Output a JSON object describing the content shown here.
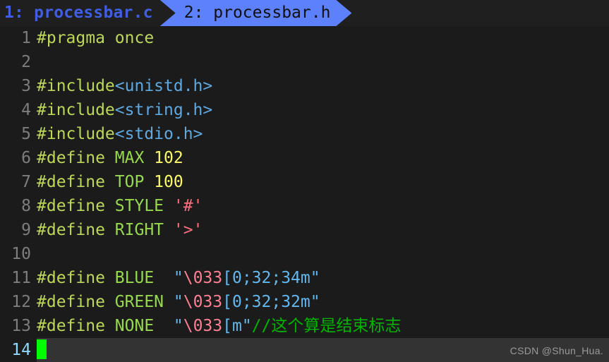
{
  "window": {
    "background": "#1b1b1b",
    "editor": "vim"
  },
  "tabline": {
    "background": "#1f1f1f",
    "tabs": [
      {
        "label": "1: processbar.c",
        "active": false,
        "text_color": "#3f5fe0"
      },
      {
        "label": "2: processbar.h",
        "active": true,
        "text_color": "#101010",
        "background": "#5d80fb"
      }
    ]
  },
  "gutter": {
    "number_color": "#7d7d7d",
    "current_number_color": "#8fd8ff"
  },
  "lines": [
    {
      "n": "1",
      "tokens": [
        {
          "t": "#pragma once",
          "c": "t-pre"
        }
      ]
    },
    {
      "n": "2",
      "tokens": []
    },
    {
      "n": "3",
      "tokens": [
        {
          "t": "#include",
          "c": "t-pre"
        },
        {
          "t": "<unistd.h>",
          "c": "t-hdr"
        }
      ]
    },
    {
      "n": "4",
      "tokens": [
        {
          "t": "#include",
          "c": "t-pre"
        },
        {
          "t": "<string.h>",
          "c": "t-hdr"
        }
      ]
    },
    {
      "n": "5",
      "tokens": [
        {
          "t": "#include",
          "c": "t-pre"
        },
        {
          "t": "<stdio.h>",
          "c": "t-hdr"
        }
      ]
    },
    {
      "n": "6",
      "tokens": [
        {
          "t": "#define ",
          "c": "t-pre"
        },
        {
          "t": "MAX ",
          "c": "t-macro"
        },
        {
          "t": "102",
          "c": "t-num"
        }
      ]
    },
    {
      "n": "7",
      "tokens": [
        {
          "t": "#define ",
          "c": "t-pre"
        },
        {
          "t": "TOP ",
          "c": "t-macro"
        },
        {
          "t": "100",
          "c": "t-num"
        }
      ]
    },
    {
      "n": "8",
      "tokens": [
        {
          "t": "#define ",
          "c": "t-pre"
        },
        {
          "t": "STYLE ",
          "c": "t-macro"
        },
        {
          "t": "'#'",
          "c": "t-char"
        }
      ]
    },
    {
      "n": "9",
      "tokens": [
        {
          "t": "#define ",
          "c": "t-pre"
        },
        {
          "t": "RIGHT ",
          "c": "t-macro"
        },
        {
          "t": "'>'",
          "c": "t-char"
        }
      ]
    },
    {
      "n": "10",
      "tokens": []
    },
    {
      "n": "11",
      "tokens": [
        {
          "t": "#define ",
          "c": "t-pre"
        },
        {
          "t": "BLUE  ",
          "c": "t-macro"
        },
        {
          "t": "\"",
          "c": "t-str"
        },
        {
          "t": "\\033",
          "c": "t-esc"
        },
        {
          "t": "[0;32;34m\"",
          "c": "t-str"
        }
      ]
    },
    {
      "n": "12",
      "tokens": [
        {
          "t": "#define ",
          "c": "t-pre"
        },
        {
          "t": "GREEN ",
          "c": "t-macro"
        },
        {
          "t": "\"",
          "c": "t-str"
        },
        {
          "t": "\\033",
          "c": "t-esc"
        },
        {
          "t": "[0;32;32m\"",
          "c": "t-str"
        }
      ]
    },
    {
      "n": "13",
      "tokens": [
        {
          "t": "#define ",
          "c": "t-pre"
        },
        {
          "t": "NONE  ",
          "c": "t-macro"
        },
        {
          "t": "\"",
          "c": "t-str"
        },
        {
          "t": "\\033",
          "c": "t-esc"
        },
        {
          "t": "[m\"",
          "c": "t-str"
        },
        {
          "t": "//这个算是结束标志",
          "c": "t-cmt"
        }
      ]
    },
    {
      "n": "14",
      "tokens": [],
      "current": true,
      "cursor": true
    }
  ],
  "cursor": {
    "color": "#00ff00",
    "line": "14",
    "column": "1"
  },
  "watermark": {
    "text": "CSDN @Shun_Hua."
  }
}
